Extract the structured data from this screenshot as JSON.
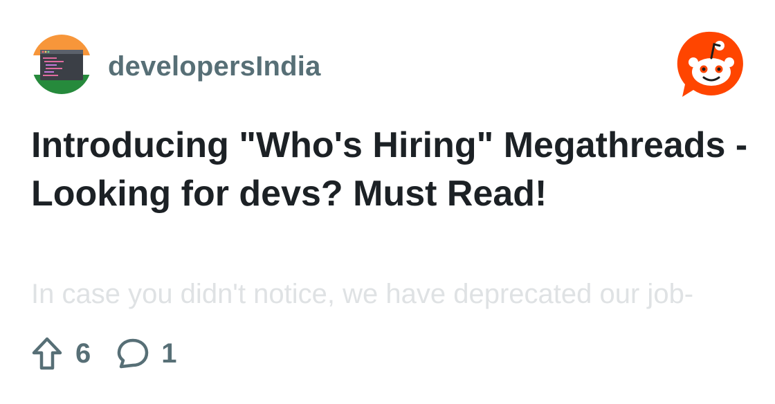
{
  "subreddit": {
    "name": "developersIndia",
    "avatar_icon": "terminal-flag-icon"
  },
  "brand": {
    "logo_icon": "reddit-snoo-icon",
    "accent_color": "#ff4500"
  },
  "post": {
    "title": "Introducing \"Who's Hiring\" Megathreads - Looking for devs? Must Read!",
    "preview": "In case you didn't notice, we have deprecated our job-"
  },
  "stats": {
    "upvotes": "6",
    "upvote_icon": "upvote-arrow-icon",
    "comments": "1",
    "comment_icon": "comment-bubble-icon"
  },
  "colors": {
    "title": "#1c2125",
    "muted": "#576f76",
    "preview": "#dfe2e4"
  }
}
